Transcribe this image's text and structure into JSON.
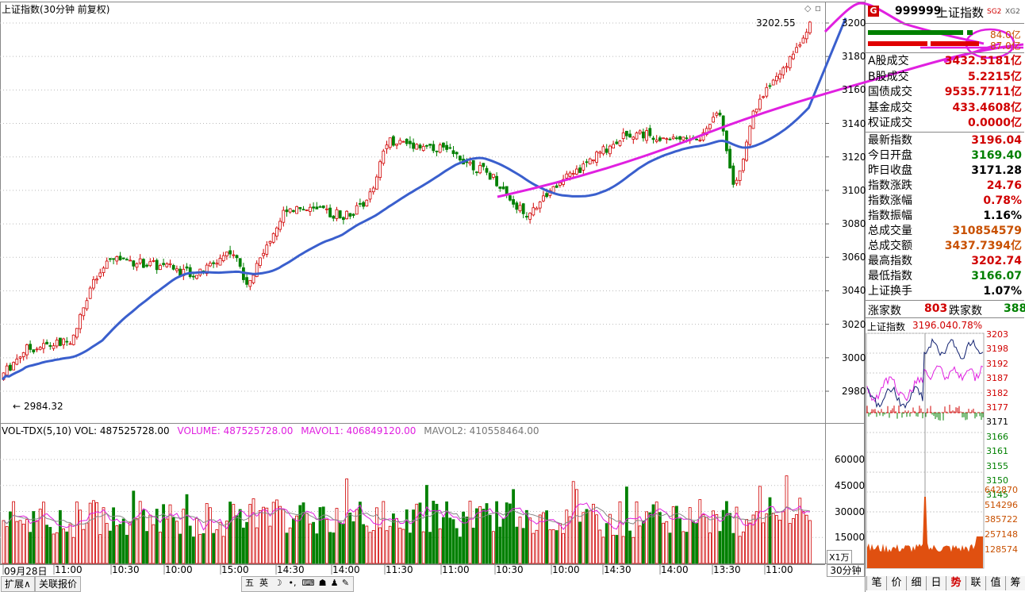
{
  "chart_header": {
    "title": "上证指数(30分钟 前复权)",
    "high_label": "3202.55",
    "low_label": "2984.32"
  },
  "price_axis": {
    "ticks": [
      "3200",
      "3180",
      "3160",
      "3140",
      "3120",
      "3100",
      "3080",
      "3060",
      "3040",
      "3020",
      "3000",
      "2980"
    ]
  },
  "volume_header": {
    "indicator": "VOL-TDX(5,10)",
    "vol": "VOL: 487525728.00",
    "volume": "VOLUME: 487525728.00",
    "mavol1": "MAVOL1: 406849120.00",
    "mavol2": "MAVOL2: 410558464.00"
  },
  "volume_axis": {
    "ticks": [
      "60000",
      "45000",
      "30000",
      "15000"
    ],
    "unit": "X1万"
  },
  "time_axis": {
    "labels": [
      "09月28日",
      "11:00",
      "10:30",
      "10:00",
      "15:00",
      "14:30",
      "14:00",
      "11:30",
      "11:00",
      "10:30",
      "10:00",
      "14:30",
      "14:00",
      "13:30",
      "11:00"
    ]
  },
  "period_tab": "30分钟",
  "bottom_bar": {
    "expand_button": "扩展∧",
    "related_quotes": "关联报价",
    "ime_buttons": [
      "五",
      "英",
      "☽",
      "•,",
      "⌨",
      "☗",
      "♟",
      "✎"
    ]
  },
  "right_panel": {
    "badge": "G",
    "code": "999999",
    "name": "上证指数",
    "tag1": "SG2",
    "tag2": "XG2",
    "bar1_value": "84.0亿",
    "bar2_value": "87.0亿",
    "turnover_rows": [
      {
        "label": "A股成交",
        "value": "3432.5181亿"
      },
      {
        "label": "B股成交",
        "value": "5.2215亿"
      },
      {
        "label": "国债成交",
        "value": "9535.7711亿"
      },
      {
        "label": "基金成交",
        "value": "433.4608亿"
      },
      {
        "label": "权证成交",
        "value": "0.0000亿"
      }
    ],
    "quote_rows": [
      {
        "label": "最新指数",
        "value": "3196.04",
        "color": "red"
      },
      {
        "label": "今日开盘",
        "value": "3169.40",
        "color": "green"
      },
      {
        "label": "昨日收盘",
        "value": "3171.28",
        "color": "black"
      },
      {
        "label": "指数涨跌",
        "value": "24.76",
        "color": "red"
      },
      {
        "label": "指数涨幅",
        "value": "0.78%",
        "color": "red"
      },
      {
        "label": "指数振幅",
        "value": "1.16%",
        "color": "black"
      },
      {
        "label": "总成交量",
        "value": "310854579",
        "color": "orange"
      },
      {
        "label": "总成交额",
        "value": "3437.7394亿",
        "color": "orange"
      },
      {
        "label": "最高指数",
        "value": "3202.74",
        "color": "red"
      },
      {
        "label": "最低指数",
        "value": "3166.07",
        "color": "green"
      },
      {
        "label": "上证换手",
        "value": "1.07%",
        "color": "black"
      }
    ],
    "up_label": "涨家数",
    "up_value": "803",
    "down_label": "跌家数",
    "down_value": "388",
    "mini_title": "上证指数",
    "mini_price": "3196.04",
    "mini_pct": "0.78%",
    "mini_price_ticks": [
      "3203",
      "3198",
      "3192",
      "3187",
      "3182",
      "3177",
      "3171",
      "3166",
      "3161",
      "3155",
      "3150",
      "3145"
    ],
    "mini_volume_ticks": [
      "642870",
      "514296",
      "385722",
      "257148",
      "128574"
    ],
    "bottom_tabs": [
      "笔",
      "价",
      "细",
      "日",
      "势",
      "联",
      "值",
      "筹"
    ]
  },
  "colors": {
    "up": "#d00000",
    "down": "#008000",
    "ma_line": "#3a5fcd",
    "annotation": "#e020e0"
  }
}
